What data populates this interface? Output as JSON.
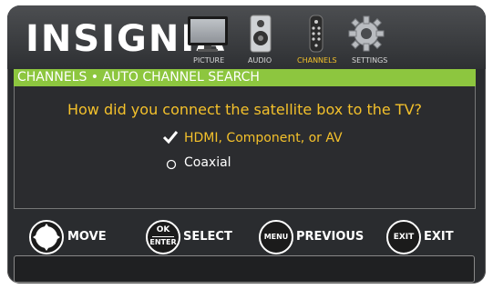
{
  "brand": "INSIGNIA",
  "tabs": [
    {
      "label": "PICTURE",
      "icon": "tv-icon",
      "active": false
    },
    {
      "label": "AUDIO",
      "icon": "speaker-icon",
      "active": false
    },
    {
      "label": "CHANNELS",
      "icon": "remote-icon",
      "active": true
    },
    {
      "label": "SETTINGS",
      "icon": "gear-icon",
      "active": false
    }
  ],
  "title": "CHANNELS • AUTO CHANNEL SEARCH",
  "question": "How did you connect the satellite box to the TV?",
  "options": [
    {
      "label": "HDMI, Component, or AV",
      "selected": true
    },
    {
      "label": "Coaxial",
      "selected": false
    }
  ],
  "footer": {
    "move": {
      "icon_text": "",
      "label": "MOVE"
    },
    "select": {
      "icon_text_top": "OK",
      "icon_text_bottom": "ENTER",
      "label": "SELECT"
    },
    "previous": {
      "icon_text": "MENU",
      "label": "PREVIOUS"
    },
    "exit": {
      "icon_text": "EXIT",
      "label": "EXIT"
    }
  },
  "colors": {
    "accent_green": "#8dc63f",
    "question_yellow": "#f4c12b",
    "active_tab": "#f2c02a"
  }
}
